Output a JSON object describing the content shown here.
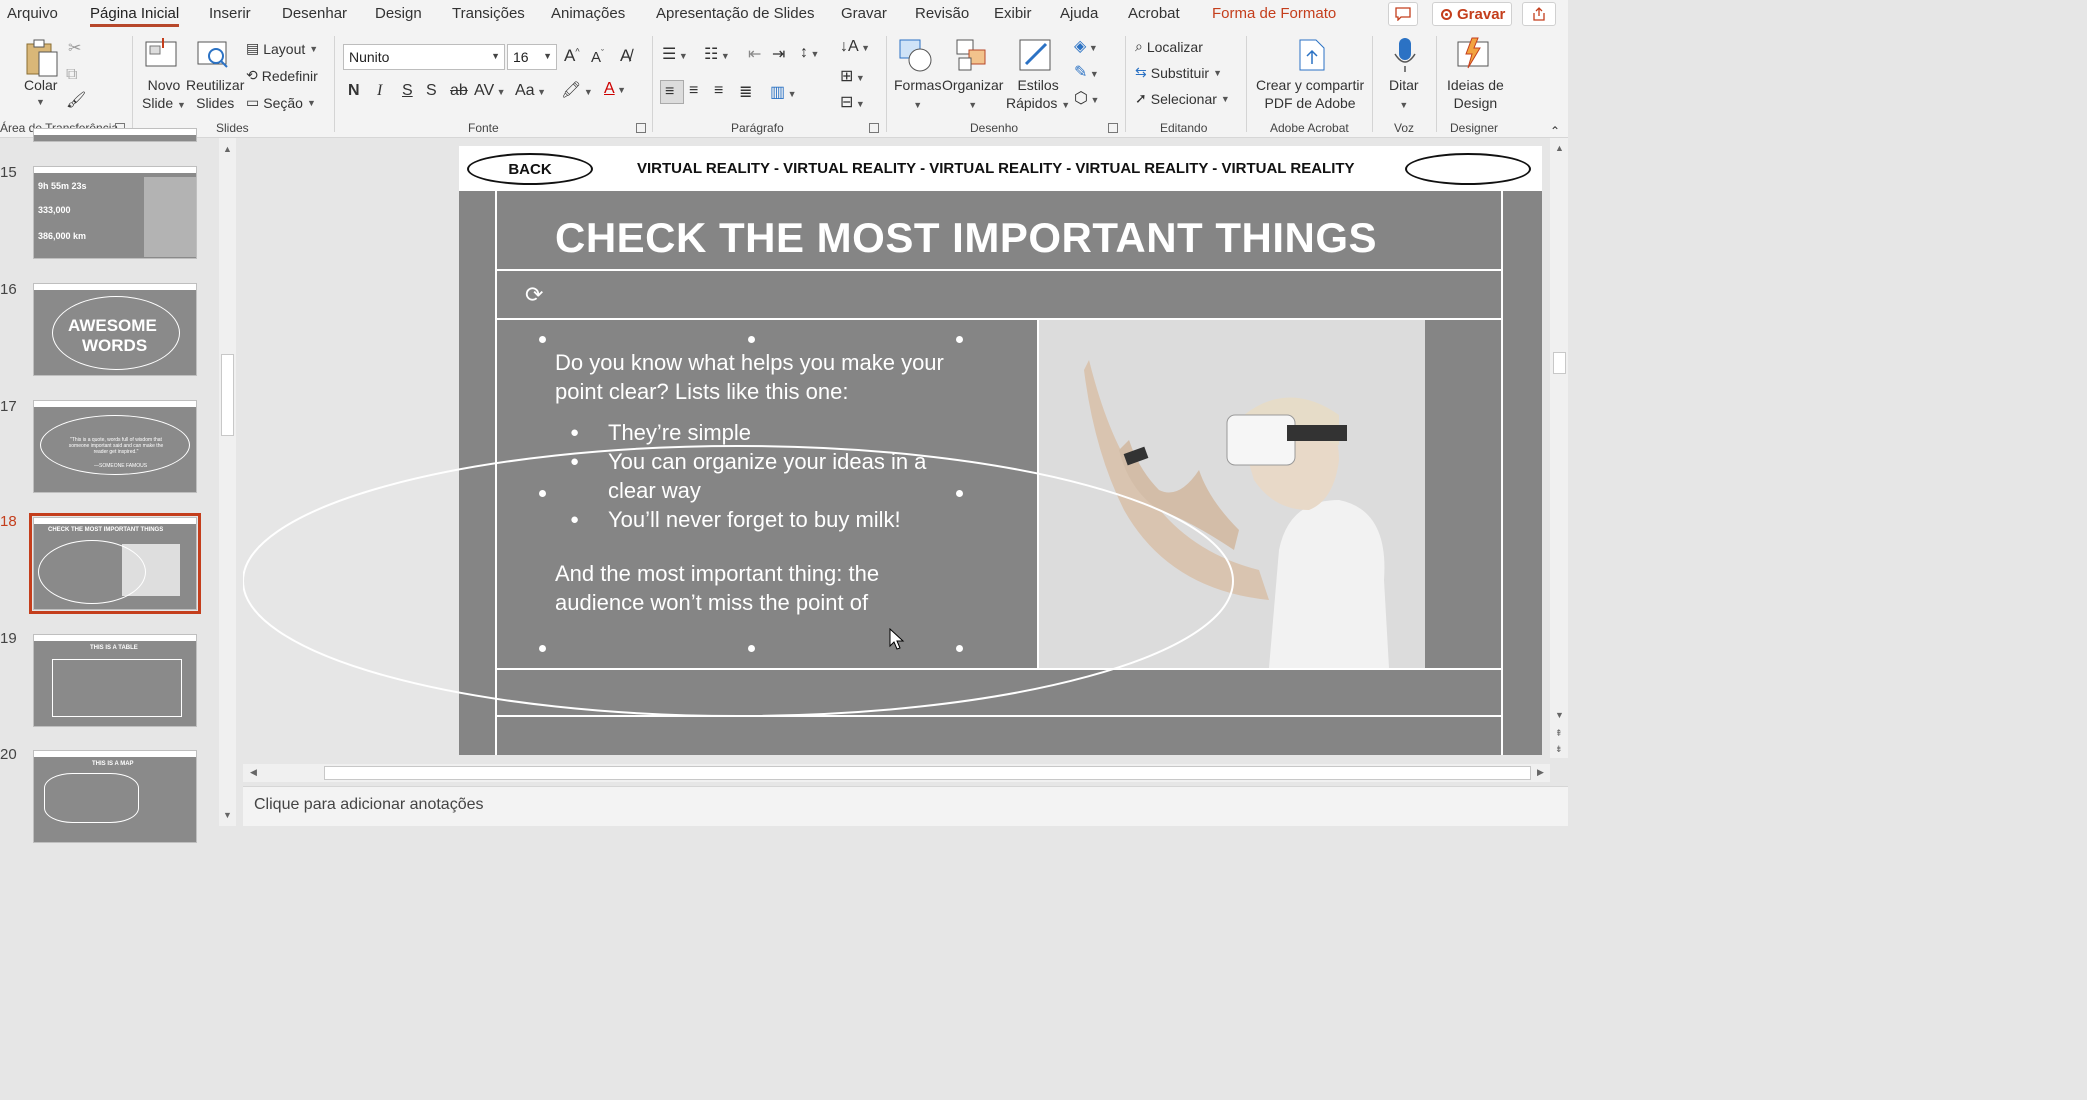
{
  "menu": {
    "items": [
      "Arquivo",
      "Página Inicial",
      "Inserir",
      "Desenhar",
      "Design",
      "Transições",
      "Animações",
      "Apresentação de Slides",
      "Gravar",
      "Revisão",
      "Exibir",
      "Ajuda",
      "Acrobat",
      "Forma de Formato"
    ],
    "active": "Página Inicial",
    "record_label": "Gravar"
  },
  "ribbon": {
    "clipboard": {
      "paste": "Colar",
      "group": "Área de Transferência"
    },
    "slides": {
      "new_slide_1": "Novo",
      "new_slide_2": "Slide",
      "reuse_1": "Reutilizar",
      "reuse_2": "Slides",
      "layout": "Layout",
      "reset": "Redefinir",
      "section": "Seção",
      "group": "Slides"
    },
    "font": {
      "name": "Nunito",
      "size": "16",
      "bold": "N",
      "italic": "I",
      "underline": "S",
      "shadow": "S",
      "strike": "ab",
      "spacing": "AV",
      "case": "Aa",
      "group": "Fonte"
    },
    "paragraph": {
      "group": "Parágrafo"
    },
    "drawing": {
      "shapes": "Formas",
      "arrange": "Organizar",
      "styles_1": "Estilos",
      "styles_2": "Rápidos",
      "group": "Desenho"
    },
    "editing": {
      "find": "Localizar",
      "replace": "Substituir",
      "select": "Selecionar",
      "group": "Editando"
    },
    "acrobat": {
      "create_1": "Crear y compartir",
      "create_2": "PDF de Adobe",
      "group": "Adobe Acrobat"
    },
    "voice": {
      "dictate": "Ditar",
      "group": "Voz"
    },
    "designer": {
      "ideas_1": "Ideias de",
      "ideas_2": "Design",
      "group": "Designer"
    }
  },
  "thumbnails": [
    {
      "num": "15",
      "line1": "9h 55m 23s",
      "line2": "333,000",
      "line3": "386,000 km"
    },
    {
      "num": "16",
      "line1": "AWESOME",
      "line2": "WORDS"
    },
    {
      "num": "17",
      "quote": "\"This is a quote, words full of wisdom that someone important said and can make the reader get inspired.\"",
      "author": "—SOMEONE FAMOUS"
    },
    {
      "num": "18",
      "title": "CHECK THE MOST IMPORTANT THINGS"
    },
    {
      "num": "19",
      "title": "THIS IS A TABLE"
    },
    {
      "num": "20",
      "title": "THIS IS A MAP"
    }
  ],
  "slide": {
    "back": "BACK",
    "header": "VIRTUAL REALITY  - VIRTUAL REALITY - VIRTUAL REALITY  - VIRTUAL REALITY - VIRTUAL REALITY",
    "title": "CHECK THE MOST IMPORTANT THINGS",
    "intro": "Do you know what helps you make your point clear? Lists like this one:",
    "bullets": [
      "They’re simple",
      "You can organize your ideas in a clear way",
      "You’ll never forget to buy milk!"
    ],
    "outro": "And the most important thing: the audience won’t miss the point of"
  },
  "notes": {
    "placeholder": "Clique para adicionar anotações"
  },
  "colors": {
    "accent": "#c43e1c",
    "slide_bg": "#858585"
  }
}
